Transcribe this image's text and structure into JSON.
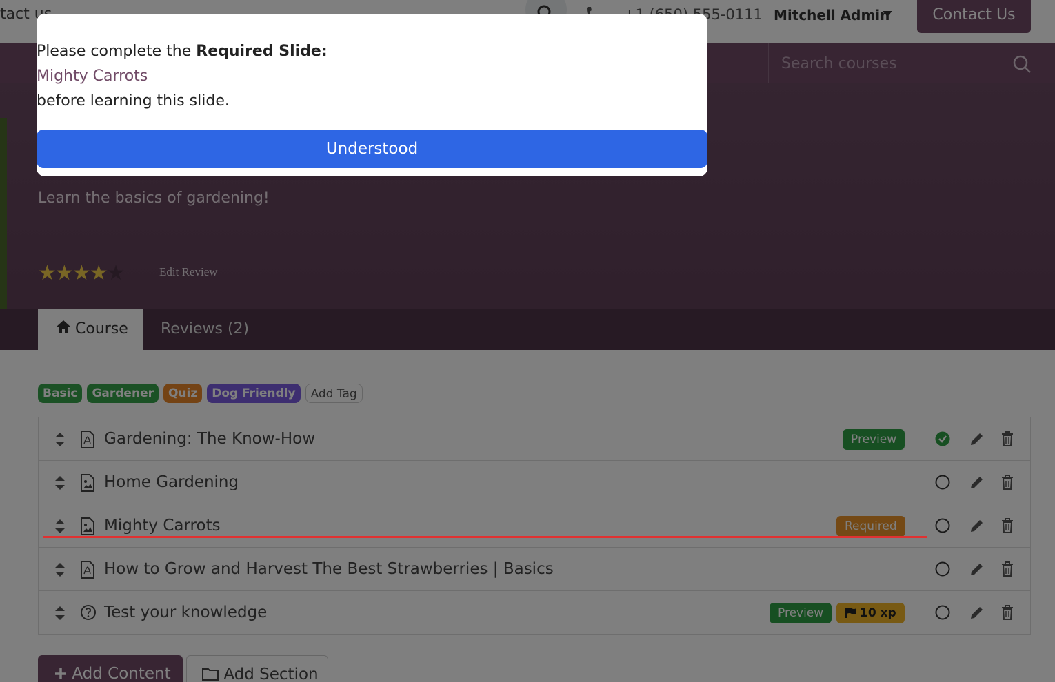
{
  "header": {
    "contact_link": "ntact us",
    "phone": "+1 (650) 555-0111",
    "user": "Mitchell Admin",
    "contact_button": "Contact Us"
  },
  "subnav": {
    "search_placeholder": "Search courses"
  },
  "course": {
    "subtitle": "Learn the basics of gardening!",
    "rating_stars": 4,
    "rating_max": 5,
    "edit_review": "Edit Review"
  },
  "tabs": [
    {
      "label": "Course",
      "active": true
    },
    {
      "label": "Reviews (2)",
      "active": false
    }
  ],
  "tags": [
    {
      "label": "Basic",
      "color": "#37a34a"
    },
    {
      "label": "Gardener",
      "color": "#37a34a"
    },
    {
      "label": "Quiz",
      "color": "#e8862a"
    },
    {
      "label": "Dog Friendly",
      "color": "#7b5ce0"
    },
    {
      "label": "Add Tag",
      "color": "#ffffff"
    }
  ],
  "slides": [
    {
      "icon": "pdf-file-icon",
      "title": "Gardening: The Know-How",
      "badges": [
        "Preview"
      ],
      "completed": true
    },
    {
      "icon": "image-file-icon",
      "title": "Home Gardening",
      "badges": [],
      "completed": false
    },
    {
      "icon": "image-file-icon",
      "title": "Mighty Carrots",
      "badges": [
        "Required"
      ],
      "completed": false
    },
    {
      "icon": "pdf-file-icon",
      "title": "How to Grow and Harvest The Best Strawberries | Basics",
      "badges": [],
      "completed": false
    },
    {
      "icon": "question-circle-icon",
      "title": "Test your knowledge",
      "badges": [
        "Preview",
        "10 xp"
      ],
      "completed": false
    }
  ],
  "actions": {
    "add_content": "Add Content",
    "add_section": "Add Section"
  },
  "modal": {
    "prefix": "Please complete the",
    "required_label": "Required Slide:",
    "slide_name": "Mighty Carrots",
    "suffix": "before learning this slide.",
    "button": "Understood"
  },
  "colors": {
    "brand": "#714b67",
    "primary_button": "#2e66e4",
    "success": "#2f9e44",
    "warning": "#e8932a",
    "annotation_line": "#e03131"
  }
}
